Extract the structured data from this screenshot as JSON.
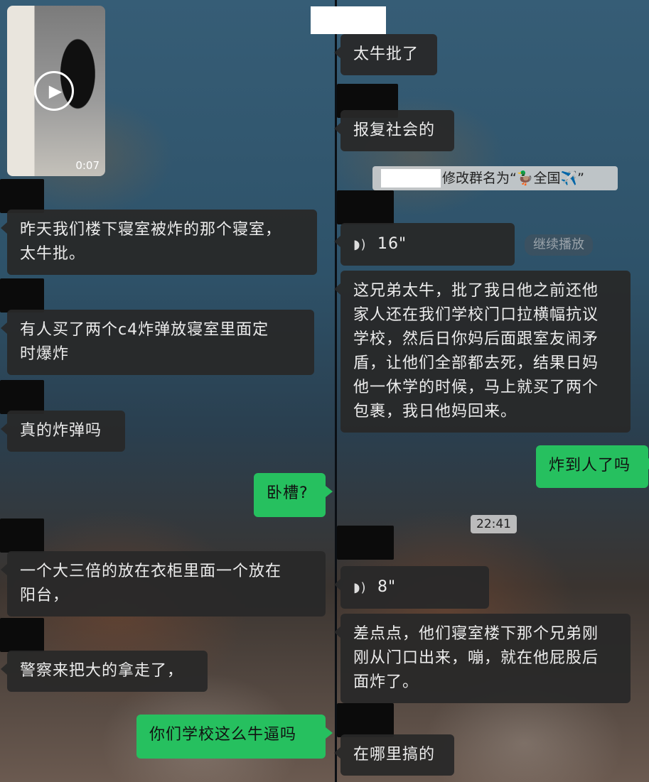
{
  "left": {
    "video": {
      "duration": "0:07"
    },
    "messages": [
      "昨天我们楼下寝室被炸的那个寝室，\n太牛批。",
      "有人买了两个c4炸弹放寝室里面定\n时爆炸",
      "真的炸弹吗",
      "卧槽?",
      "一个大三倍的放在衣柜里面一个放在\n阳台，",
      "警察来把大的拿走了，",
      "你们学校这么牛逼吗"
    ]
  },
  "right": {
    "messages": [
      "太牛批了",
      "报复社会的",
      "这兄弟太牛，批了我日他之前还他\n家人还在我们学校门口拉横幅抗议\n学校，然后日你妈后面跟室友闹矛\n盾，让他们全部都去死，结果日妈\n他一休学的时候，马上就买了两个\n包裹，我日他妈回来。",
      "炸到人了吗",
      "差点点，他们寝室楼下那个兄弟刚\n刚从门口出来，嘣，就在他屁股后\n面炸了。",
      "在哪里搞的"
    ],
    "system_notice": "修改群名为“🦆全国✈️”",
    "voice_1": "16\"",
    "continue_play": "继续播放",
    "timestamp": "22:41",
    "voice_2": "8\""
  },
  "colors": {
    "outgoing_bubble": "#26c05f",
    "incoming_bubble": "#282828"
  },
  "icons": {
    "play": "play-icon",
    "voice": "voice-wave-icon"
  }
}
